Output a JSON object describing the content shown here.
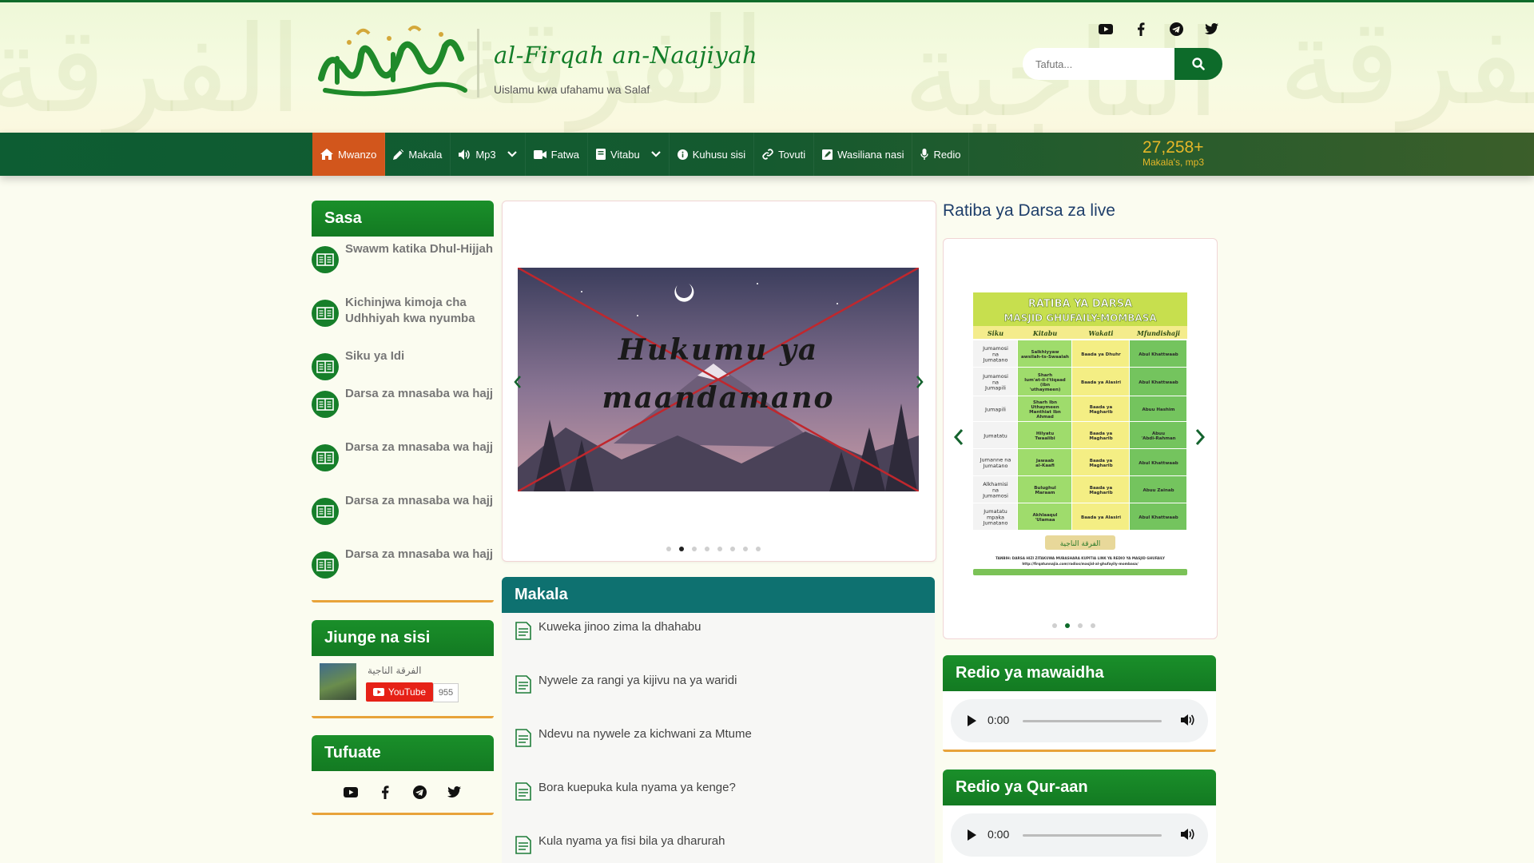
{
  "site": {
    "title": "al-Firqah an-Naajiyah",
    "tagline": "Uislamu kwa ufahamu wa Salaf",
    "logo_text": "الفرقة الناجية"
  },
  "header": {
    "social": [
      "youtube-icon",
      "facebook-icon",
      "telegram-icon",
      "twitter-icon"
    ],
    "search": {
      "placeholder": "Tafuta...",
      "button_icon": "search-icon"
    }
  },
  "nav": {
    "items": [
      {
        "label": "Mwanzo",
        "icon": "home-icon",
        "active": true
      },
      {
        "label": "Makala",
        "icon": "pencil-icon"
      },
      {
        "label": "Mp3",
        "icon": "speaker-icon",
        "dropdown": true
      },
      {
        "label": "Fatwa",
        "icon": "video-icon"
      },
      {
        "label": "Vitabu",
        "icon": "book-icon",
        "dropdown": true
      },
      {
        "label": "Kuhusu sisi",
        "icon": "info-icon"
      },
      {
        "label": "Tovuti",
        "icon": "link-icon"
      },
      {
        "label": "Wasiliana nasi",
        "icon": "contact-icon"
      },
      {
        "label": "Redio",
        "icon": "microphone-icon"
      }
    ],
    "counter": {
      "number": "27,258+",
      "label": "Makala's, mp3"
    }
  },
  "sidebar": {
    "sasa": {
      "title": "Sasa",
      "items": [
        "Swawm katika Dhul-Hijjah",
        "Kichinjwa kimoja cha Udhhiyah kwa nyumba",
        "Siku ya Idi",
        "Darsa za mnasaba wa hajj",
        "Darsa za mnasaba wa hajj",
        "Darsa za mnasaba wa hajj",
        "Darsa za mnasaba wa hajj"
      ]
    },
    "join": {
      "title": "Jiunge na sisi",
      "channel_name": "الفرقة الناجية",
      "button_label": "YouTube",
      "subscriber_count": "955"
    },
    "follow": {
      "title": "Tufuate",
      "icons": [
        "youtube-icon",
        "facebook-icon",
        "telegram-icon",
        "twitter-icon"
      ]
    }
  },
  "slider": {
    "slide_text_line1": "Hukumu ya",
    "slide_text_line2": "maandamano",
    "dot_count": 8,
    "active_dot": 2
  },
  "makala": {
    "title": "Makala",
    "items": [
      "Kuweka jinoo zima la dhahabu",
      "Nywele za rangi ya kijivu na ya waridi",
      "Ndevu na nywele za kichwani za Mtume",
      "Bora kuepuka kula nyama ya kenge?",
      "Kula nyama ya fisi bila ya dharurah"
    ]
  },
  "ratiba": {
    "title": "Ratiba ya Darsa za live",
    "poster": {
      "heading1": "RATIBA YA DARSA",
      "heading2": "MASJID GHUFAILY-MOMBASA",
      "columns": [
        "Siku",
        "Kitabu",
        "Wakati",
        "Mfundishaji"
      ],
      "rows": [
        [
          "Jumamosi na Jumatano",
          "Salkhiyyaw awsilah-ts-Swaalah",
          "Baada ya Dhuhr",
          "Abul Khattwaab"
        ],
        [
          "Jumamosi na Jumapili",
          "Sharh lum'at-il-I'tiqaad (ibn 'uthaymeen)",
          "Baada ya Alasiri",
          "Abul Khattwaab"
        ],
        [
          "Jumapili",
          "Sharh Ibn Uthaymeen Manthiat Ibn Ahmad",
          "Baada ya Magharib",
          "Abuu Hashim"
        ],
        [
          "Jumatatu",
          "Hilyatu Twaalibi",
          "Baada ya Magharib",
          "Abuu 'Abdi-Rahman"
        ],
        [
          "Jumanne na Jumatano",
          "Jawaab al-Kaafi",
          "Baada ya Magharib",
          "Abul Khattwaab"
        ],
        [
          "Alkhamisi na Jumamosi",
          "Bulughul Maraam",
          "Baada ya Magharib",
          "Abuu Zainab"
        ],
        [
          "Jumatatu mpaka Jumatano",
          "Akhlaaqul 'Ulamaa",
          "Baada ya Alasiri",
          "Abul Khattwaab"
        ]
      ],
      "footer": "TANBIH: DARSA HIZI ZITAKUWA MUBASHARA KUPITIA LINK YA REDIO YA MASJID GHUFAILY",
      "footer_url": "http://firqatunnajia.com/radios/masjid-al-ghufayily-mombasa/"
    },
    "dot_count": 4,
    "active_dot": 2
  },
  "radio1": {
    "title": "Redio ya mawaidha",
    "time": "0:00"
  },
  "radio2": {
    "title": "Redio ya Qur-aan",
    "time": "0:00"
  },
  "colors": {
    "green": "#137a22",
    "nav_dark": "#0d5d33",
    "active_nav": "#d2561c",
    "teal": "#0e7170",
    "gold": "#e6b728",
    "accent_bottom": "#e8a33a"
  }
}
